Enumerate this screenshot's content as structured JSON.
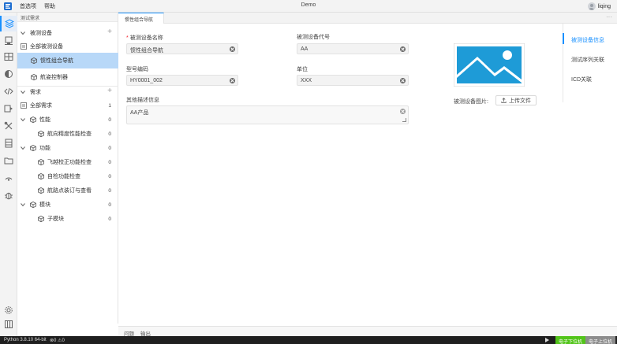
{
  "menubar": {
    "menu_items": [
      "首选项",
      "帮助"
    ],
    "window_title": "Demo",
    "user_name": "liqing"
  },
  "sidebar": {
    "title": "测试需求",
    "devices_section": "被测设备",
    "device_rows": [
      {
        "label": "全部被测设备"
      },
      {
        "label": "惯性组合导航"
      },
      {
        "label": "航姿控制器"
      }
    ],
    "requirements_section": "需求",
    "requirement_rows": [
      {
        "label": "全部需求",
        "count": "1"
      },
      {
        "label": "性能",
        "count": "0"
      },
      {
        "label": "航向精度性能检查",
        "count": "0"
      },
      {
        "label": "功能",
        "count": "0"
      },
      {
        "label": "飞越校正功能检查",
        "count": "0"
      },
      {
        "label": "自检功能检查",
        "count": "0"
      },
      {
        "label": "航路点装订与查看",
        "count": "0"
      },
      {
        "label": "模块",
        "count": "0"
      },
      {
        "label": "子模块",
        "count": "0"
      }
    ]
  },
  "editor": {
    "tab_label": "惯性组合导航",
    "form": {
      "device_name_label": "被测设备名称",
      "device_name_value": "惯性组合导航",
      "device_code_label": "被测设备代号",
      "device_code_value": "AA",
      "model_label": "型号编码",
      "model_value": "HY0001_002",
      "unit_label": "单位",
      "unit_value": "XXX",
      "description_label": "其他描述信息",
      "description_value": "AA产品",
      "image_label": "被测设备图片:",
      "upload_label": "上传文件"
    },
    "anchors": [
      "被测设备信息",
      "测试序列关联",
      "ICD关联"
    ]
  },
  "panel": {
    "tabs": [
      "问题",
      "输出"
    ]
  },
  "statusbar": {
    "python_version": "Python 3.8.10 64-bit",
    "errors": "0",
    "warnings": "0",
    "btn_upper": "电子下位机",
    "btn_lower": "电子上位机"
  },
  "colors": {
    "accent": "#1890ff",
    "selected_bg": "#b8d8f8",
    "image_placeholder": "#1e9bd7",
    "status_green": "#52c41a"
  }
}
